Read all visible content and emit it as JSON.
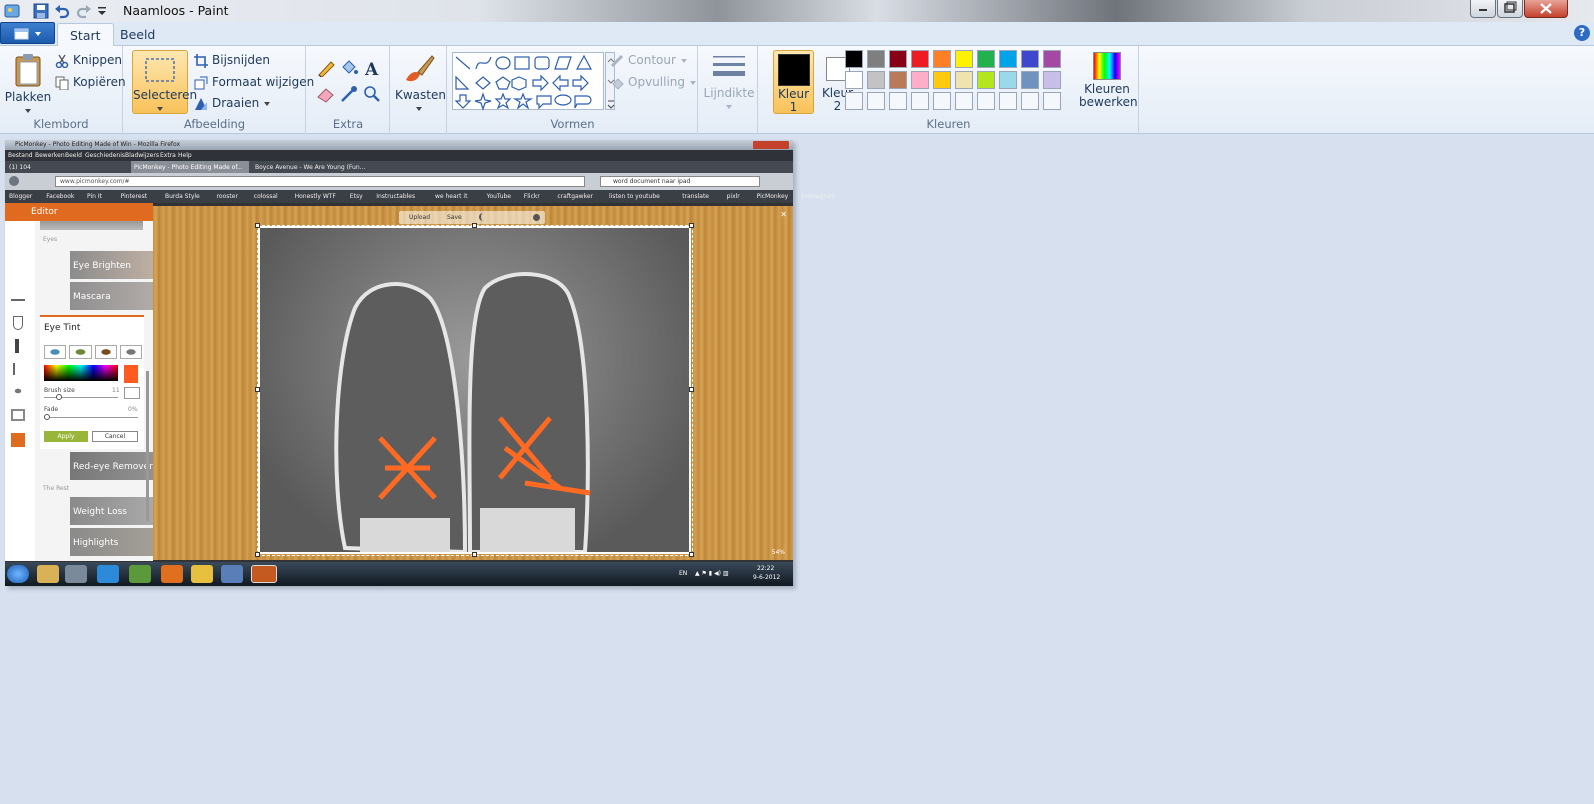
{
  "window": {
    "title": "Naamloos - Paint"
  },
  "tabs": [
    {
      "label": "Start"
    },
    {
      "label": "Beeld"
    }
  ],
  "ribbon": {
    "clipboard": {
      "paste": "Plakken",
      "cut": "Knippen",
      "copy": "Kopiëren",
      "group": "Klembord"
    },
    "image": {
      "select": "Selecteren",
      "crop": "Bijsnijden",
      "resize": "Formaat wijzigen",
      "rotate": "Draaien",
      "group": "Afbeelding"
    },
    "tools": {
      "group": "Extra"
    },
    "brushes": {
      "label": "Kwasten"
    },
    "shapes": {
      "outline": "Contour",
      "fill": "Opvulling",
      "group": "Vormen"
    },
    "size": {
      "label": "Lijndikte"
    },
    "colors": {
      "color1": "Kleur",
      "color1_num": "1",
      "color2": "Kleur",
      "color2_num": "2",
      "edit": "Kleuren",
      "edit2": "bewerken",
      "group": "Kleuren",
      "color1_value": "#000000",
      "color2_value": "#ffffff",
      "palette_row1": [
        "#000000",
        "#7f7f7f",
        "#880015",
        "#ed1c24",
        "#ff7f27",
        "#fff200",
        "#22b14c",
        "#00a2e8",
        "#3f48cc",
        "#a349a4"
      ],
      "palette_row2": [
        "#ffffff",
        "#c3c3c3",
        "#b97a57",
        "#ffaec9",
        "#ffc90e",
        "#efe4b0",
        "#b5e61d",
        "#99d9ea",
        "#7092be",
        "#c8bfe7"
      ]
    }
  },
  "screenshot": {
    "ff_title": "PicMonkey - Photo Editing Made of Win - Mozilla Firefox",
    "menu": [
      "Bestand",
      "Bewerken",
      "Beeld",
      "Geschiedenis",
      "Bladwijzers",
      "Extra",
      "Help"
    ],
    "tabs": [
      "(1) 104",
      "PicMonkey - Photo Editing Made of...",
      "Boyce Avenue - We Are Young (Fun..."
    ],
    "url": "www.picmonkey.com/#",
    "search": "word document naar ipad",
    "bookmarks": [
      "Blogger",
      "Facebook",
      "Pin It",
      "Pinterest",
      "Burda Style",
      "rooster",
      "colossal",
      "Honestly WTF",
      "Etsy",
      "Instructables",
      "we heart it",
      "YouTube",
      "Flickr",
      "craftgawker",
      "listen to youtube",
      "translate",
      "pixlr",
      "PicMonkey",
      "Followgram"
    ],
    "editor": "Editor",
    "toolbar": {
      "upload": "Upload",
      "save": "Save"
    },
    "side": {
      "eyes": "Eyes",
      "eye_brighten": "Eye Brighten",
      "mascara": "Mascara",
      "eye_tint": "Eye Tint",
      "brush_size": "Brush size",
      "brush_val": "11",
      "fade": "Fade",
      "fade_val": "0%",
      "apply": "Apply",
      "cancel": "Cancel",
      "redeye": "Red-eye Remover",
      "the_rest": "The Rest",
      "weight_loss": "Weight Loss",
      "highlights": "Highlights"
    },
    "zoom": "54%",
    "tray": {
      "lang": "EN",
      "time": "22:22",
      "date": "9-6-2012"
    }
  }
}
